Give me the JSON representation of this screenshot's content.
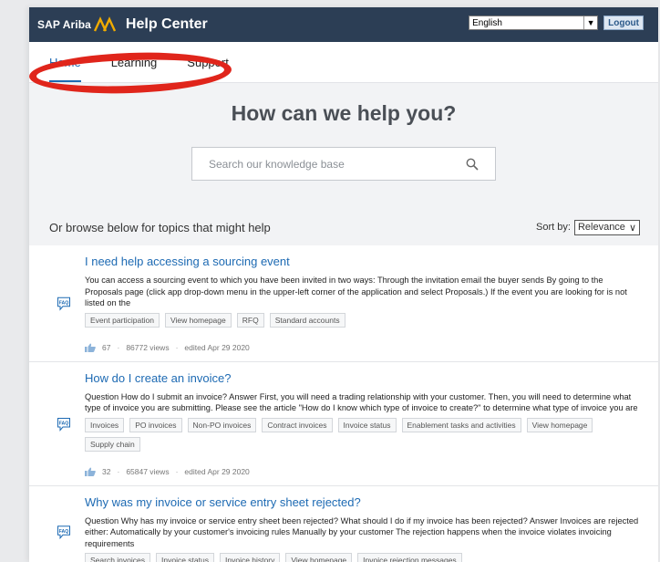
{
  "header": {
    "brand": "SAP Ariba",
    "title": "Help Center",
    "language": "English",
    "logout_label": "Logout"
  },
  "nav": {
    "tabs": [
      {
        "label": "Home",
        "active": true
      },
      {
        "label": "Learning"
      },
      {
        "label": "Support"
      }
    ]
  },
  "hero": {
    "title": "How can we help you?",
    "search_placeholder": "Search our knowledge base"
  },
  "browse": {
    "text": "Or browse below for topics that might help",
    "sort_label": "Sort by:",
    "sort_value": "Relevance"
  },
  "results": [
    {
      "badge": "FAQ",
      "title": "I need help accessing a sourcing event",
      "description": "You can access a sourcing event to which you have been invited in two ways: Through the invitation email the buyer sends By going to the Proposals page (click app drop-down menu in the upper-left corner of the application and select Proposals.) If the event you are looking for is not listed on the",
      "tags": [
        "Event participation",
        "View homepage",
        "RFQ",
        "Standard accounts"
      ],
      "likes": "67",
      "views": "86772 views",
      "edited": "edited Apr 29 2020"
    },
    {
      "badge": "FAQ",
      "title": "How do I create an invoice?",
      "description": "Question How do I submit an invoice? Answer First, you will need a trading relationship with your customer. Then, you will need to determine what type of invoice you are submitting. Please see the article \"How do I know which type of invoice to create?\" to determine what type of invoice you are",
      "tags": [
        "Invoices",
        "PO invoices",
        "Non-PO invoices",
        "Contract invoices",
        "Invoice status",
        "Enablement tasks and activities",
        "View homepage",
        "Supply chain"
      ],
      "likes": "32",
      "views": "65847 views",
      "edited": "edited Apr 29 2020"
    },
    {
      "badge": "FAQ",
      "title": "Why was my invoice or service entry sheet rejected?",
      "description": "Question Why has my invoice or service entry sheet been rejected? What should I do if my invoice has been rejected? Answer Invoices are rejected either: Automatically by your customer's invoicing rules Manually by your customer The rejection happens when the invoice violates invoicing requirements",
      "tags": [
        "Search invoices",
        "Invoice status",
        "Invoice history",
        "View homepage",
        "Invoice rejection messages"
      ]
    }
  ],
  "colors": {
    "header_bg": "#2c3e55",
    "link": "#1d6ab3",
    "annotation": "#e0251b",
    "logo": "#f0ab00"
  }
}
